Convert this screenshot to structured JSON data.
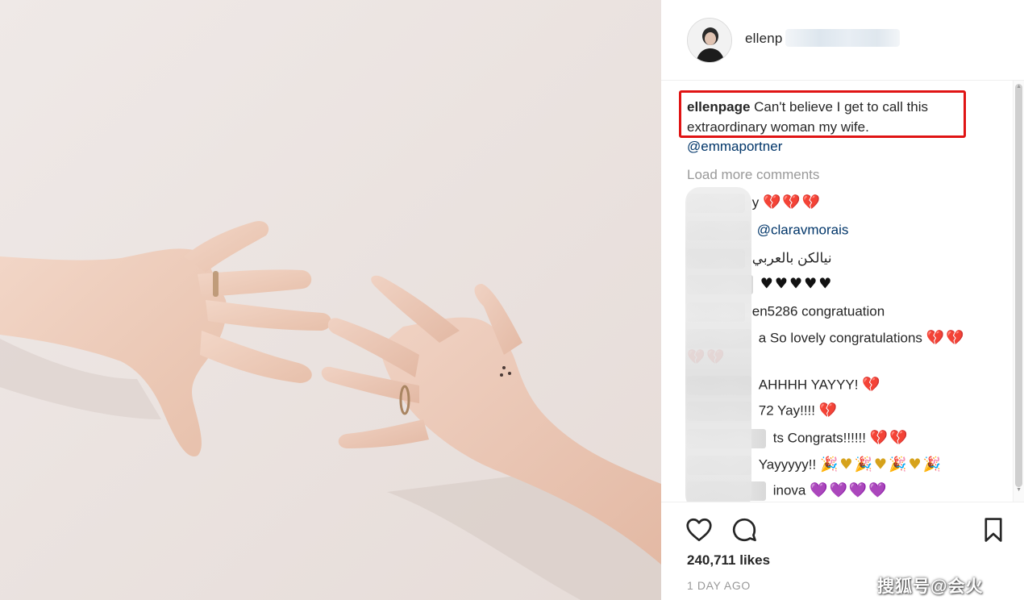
{
  "post": {
    "username": "ellenp",
    "caption_username": "ellenpage",
    "caption_text": "Can't believe I get to call this extraordinary woman my wife.",
    "mention": "@emmaportner",
    "load_more": "Load more comments",
    "likes": "240,711 likes",
    "time_ago": "1 DAY AGO"
  },
  "comments": [
    {
      "visible_text": "y",
      "emoji": "💔💔💔",
      "emoji_style": "red"
    },
    {
      "visible_text": "",
      "link": "@claravmorais"
    },
    {
      "visible_text": "نيالكن بالعربي",
      "rtl": true
    },
    {
      "visible_text": "",
      "emoji": "♥♥♥♥♥",
      "emoji_style": "black"
    },
    {
      "visible_text": "en5286 congratuation"
    },
    {
      "visible_text": "a So lovely congratulations",
      "emoji": "💔💔",
      "emoji_style": "red"
    },
    {
      "visible_text": "",
      "emoji": "💔💔",
      "emoji_style": "red"
    },
    {
      "visible_text": "AHHHH YAYYY!",
      "emoji": "💔",
      "emoji_style": "red"
    },
    {
      "visible_text": "72 Yay!!!!",
      "emoji": "💔",
      "emoji_style": "red"
    },
    {
      "visible_text": "ts Congrats!!!!!!",
      "emoji": "💔💔",
      "emoji_style": "red"
    },
    {
      "visible_text": "Yayyyyy!!",
      "emoji": "🎉♥🎉♥🎉♥🎉",
      "emoji_style": "party"
    },
    {
      "visible_text": "inova",
      "emoji": "💜💜💜💜",
      "emoji_style": "purple"
    }
  ],
  "icons": {
    "like": "heart-icon",
    "comment": "comment-icon",
    "save": "bookmark-icon"
  },
  "colors": {
    "highlight": "#e01414",
    "link": "#003569",
    "muted": "#999999",
    "heart_red": "#e0293a",
    "heart_purple": "#8c6ce0"
  },
  "watermark": "搜狐号@会火"
}
